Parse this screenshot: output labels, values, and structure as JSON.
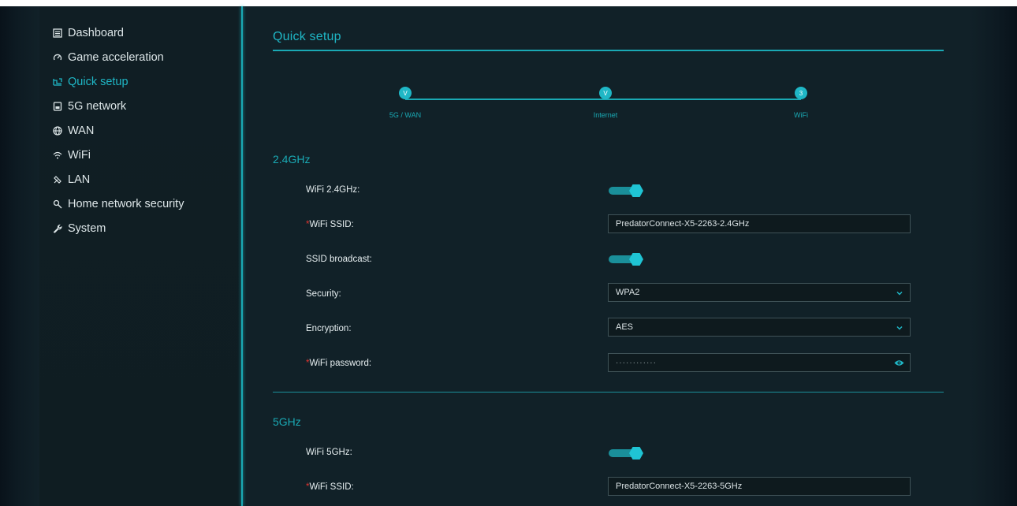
{
  "sidebar": {
    "items": [
      {
        "label": "Dashboard",
        "icon": "dashboard-icon"
      },
      {
        "label": "Game acceleration",
        "icon": "game-acceleration-icon"
      },
      {
        "label": "Quick setup",
        "icon": "quick-setup-icon",
        "active": true
      },
      {
        "label": "5G network",
        "icon": "5g-network-icon"
      },
      {
        "label": "WAN",
        "icon": "globe-icon"
      },
      {
        "label": "WiFi",
        "icon": "wifi-icon"
      },
      {
        "label": "LAN",
        "icon": "lan-icon"
      },
      {
        "label": "Home network security",
        "icon": "security-icon"
      },
      {
        "label": "System",
        "icon": "wrench-icon"
      }
    ]
  },
  "main": {
    "title": "Quick setup",
    "steps": [
      {
        "label": "5G / WAN",
        "marker": "V"
      },
      {
        "label": "Internet",
        "marker": "V"
      },
      {
        "label": "WiFi",
        "marker": "3"
      }
    ],
    "section_24": {
      "title": "2.4GHz",
      "wifi_label": "WiFi 2.4GHz:",
      "wifi_enabled": true,
      "ssid_required": "*",
      "ssid_label": "WiFi SSID:",
      "ssid_value": "PredatorConnect-X5-2263-2.4GHz",
      "broadcast_label": "SSID broadcast:",
      "broadcast_enabled": true,
      "security_label": "Security:",
      "security_value": "WPA2",
      "encryption_label": "Encryption:",
      "encryption_value": "AES",
      "password_required": "*",
      "password_label": "WiFi password:",
      "password_mask": "············"
    },
    "section_5": {
      "title": "5GHz",
      "wifi_label": "WiFi 5GHz:",
      "wifi_enabled": true,
      "ssid_required": "*",
      "ssid_label": "WiFi SSID:",
      "ssid_value": "PredatorConnect-X5-2263-5GHz"
    }
  },
  "colors": {
    "accent": "#1fb7c6",
    "background": "#112128",
    "required": "#e0332f"
  }
}
